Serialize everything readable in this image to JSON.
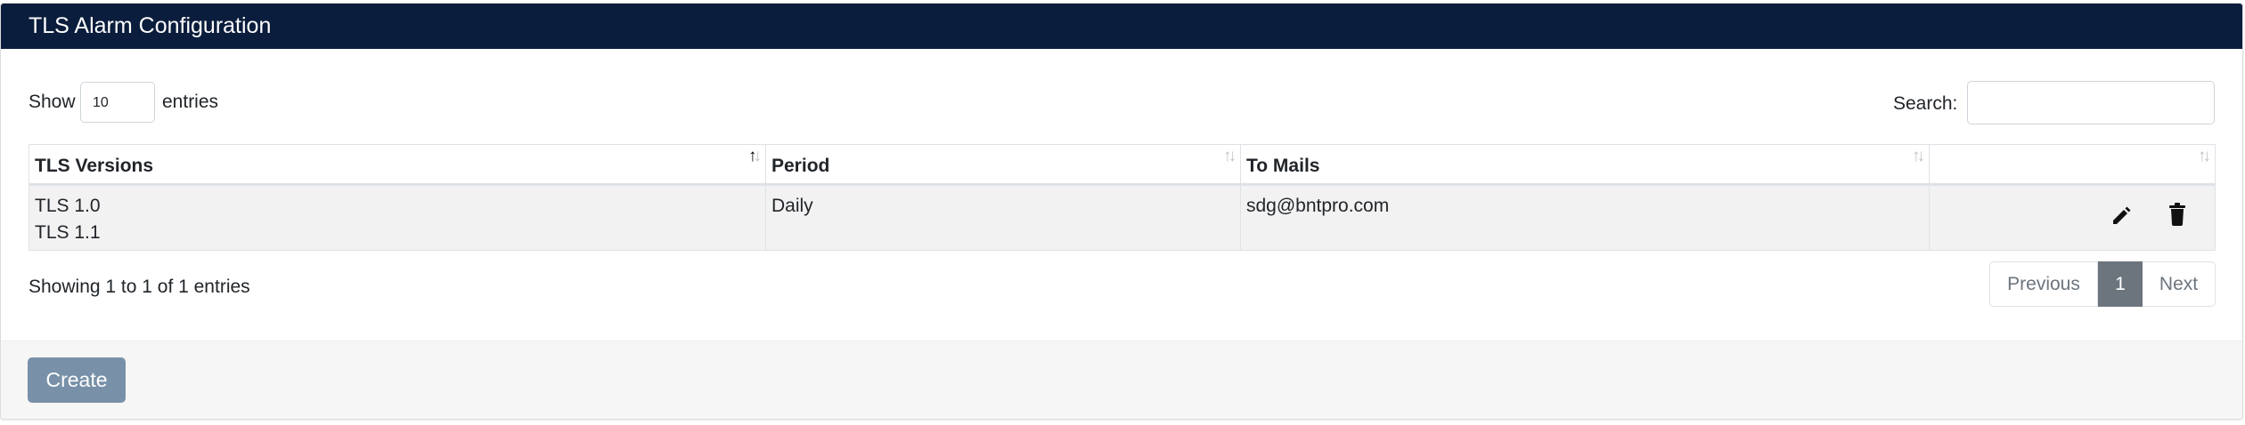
{
  "header": {
    "title": "TLS Alarm Configuration"
  },
  "length_menu": {
    "show_label": "Show",
    "value": "10",
    "entries_label": "entries"
  },
  "search": {
    "label": "Search:",
    "value": ""
  },
  "table": {
    "columns": [
      {
        "label": "TLS Versions",
        "sort": "ascending"
      },
      {
        "label": "Period",
        "sort": "none"
      },
      {
        "label": "To Mails",
        "sort": "none"
      },
      {
        "label": "",
        "sort": "none"
      }
    ],
    "rows": [
      {
        "tls_versions": [
          "TLS 1.0",
          "TLS 1.1"
        ],
        "period": "Daily",
        "to_mails": "sdg@bntpro.com"
      }
    ],
    "row_actions": [
      {
        "icon": "pencil-icon"
      },
      {
        "icon": "trash-icon"
      }
    ]
  },
  "info": {
    "text": "Showing 1 to 1 of 1 entries"
  },
  "pagination": {
    "previous": "Previous",
    "current": "1",
    "next": "Next"
  },
  "footer": {
    "create_label": "Create"
  },
  "colors": {
    "header_bg": "#0b1d3c",
    "create_button": "#7891a8",
    "active_page": "#6c757d"
  }
}
